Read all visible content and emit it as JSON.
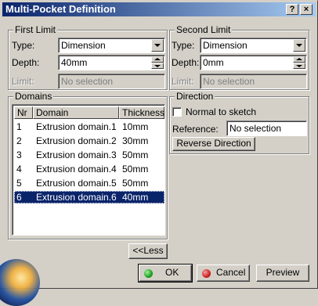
{
  "window": {
    "title": "Multi-Pocket Definition",
    "help_label": "?",
    "close_label": "×"
  },
  "first_limit": {
    "title": "First Limit",
    "type_label": "Type:",
    "type_value": "Dimension",
    "depth_label": "Depth:",
    "depth_value": "40mm",
    "limit_label": "Limit:",
    "limit_value": "No selection"
  },
  "second_limit": {
    "title": "Second Limit",
    "type_label": "Type:",
    "type_value": "Dimension",
    "depth_label": "Depth:",
    "depth_value": "0mm",
    "limit_label": "Limit:",
    "limit_value": "No selection"
  },
  "domains": {
    "title": "Domains",
    "columns": [
      "Nr",
      "Domain",
      "Thickness"
    ],
    "rows": [
      {
        "nr": "1",
        "domain": "Extrusion domain.1",
        "thickness": "10mm"
      },
      {
        "nr": "2",
        "domain": "Extrusion domain.2",
        "thickness": "30mm"
      },
      {
        "nr": "3",
        "domain": "Extrusion domain.3",
        "thickness": "50mm"
      },
      {
        "nr": "4",
        "domain": "Extrusion domain.4",
        "thickness": "50mm"
      },
      {
        "nr": "5",
        "domain": "Extrusion domain.5",
        "thickness": "50mm"
      },
      {
        "nr": "6",
        "domain": "Extrusion domain.6",
        "thickness": "40mm"
      }
    ],
    "selected_index": 5
  },
  "direction": {
    "title": "Direction",
    "normal_label": "Normal to sketch",
    "reference_label": "Reference:",
    "reference_value": "No selection",
    "reverse_button": "Reverse Direction"
  },
  "buttons": {
    "less": "<<Less",
    "ok": "OK",
    "cancel": "Cancel",
    "preview": "Preview"
  },
  "colors": {
    "title_start": "#0a246a",
    "title_end": "#a6caf0",
    "selection": "#0a246a",
    "ok_dot": "#20a020",
    "cancel_dot": "#d02020"
  }
}
